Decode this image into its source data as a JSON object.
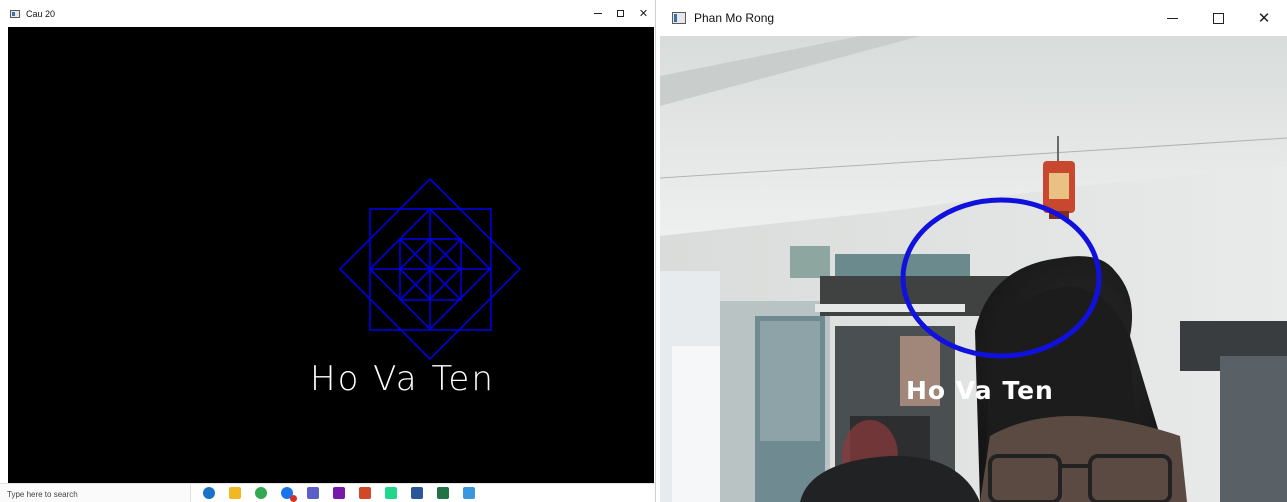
{
  "left_window": {
    "title": "Cau 20",
    "overlay_text": "Ho Va Ten"
  },
  "right_window": {
    "title": "Phan Mo Rong",
    "overlay_text": "Ho Va Ten"
  },
  "taskbar": {
    "search_placeholder": "Type here to search",
    "apps": [
      {
        "icon": "edge-icon",
        "color": "#1a73c8"
      },
      {
        "icon": "file-explorer-icon",
        "color": "#f2b824"
      },
      {
        "icon": "chrome-icon",
        "color": "#34a853"
      },
      {
        "icon": "chrome-badge-icon",
        "color": "#1a73e8"
      },
      {
        "icon": "teams-icon",
        "color": "#5b5fc7"
      },
      {
        "icon": "onenote-icon",
        "color": "#7719aa"
      },
      {
        "icon": "powerpoint-icon",
        "color": "#d24726"
      },
      {
        "icon": "pycharm-icon",
        "color": "#21d789"
      },
      {
        "icon": "word-icon",
        "color": "#2b579a"
      },
      {
        "icon": "excel-icon",
        "color": "#217346"
      },
      {
        "icon": "vscode-icon",
        "color": "#3a96dd"
      }
    ]
  },
  "colors": {
    "shape_stroke": "#0000e0",
    "ellipse_stroke": "#1111dd",
    "overlay_text": "#ffffff",
    "canvas_background": "#000000"
  }
}
